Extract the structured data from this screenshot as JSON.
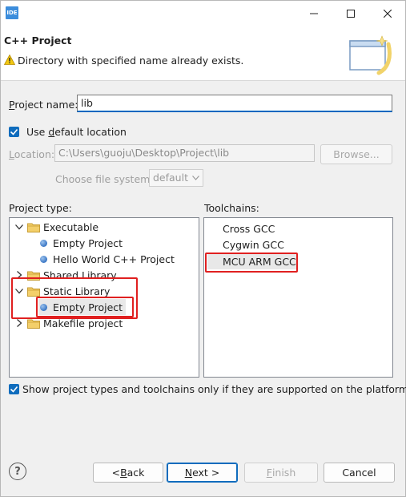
{
  "titlebar": {
    "app_icon": "IDE"
  },
  "banner": {
    "title": "C++ Project",
    "message": "Directory with specified name already exists."
  },
  "project_name": {
    "label_pre": "",
    "label_mnemonic": "P",
    "label_post": "roject name:",
    "value": "lib"
  },
  "default_location": {
    "label_pre": "Use ",
    "label_mnemonic": "d",
    "label_post": "efault location",
    "checked": true
  },
  "location": {
    "label_mnemonic": "L",
    "label_post": "ocation:",
    "value": "C:\\Users\\guoju\\Desktop\\Project\\lib",
    "browse_label": "Browse..."
  },
  "file_system": {
    "label": "Choose file system:",
    "value": "default"
  },
  "project_type": {
    "label": "Project type:",
    "items": [
      {
        "label": "Executable",
        "kind": "folder",
        "expanded": true
      },
      {
        "label": "Empty Project",
        "kind": "leaf"
      },
      {
        "label": "Hello World C++ Project",
        "kind": "leaf"
      },
      {
        "label": "Shared Library",
        "kind": "folder",
        "expanded": false
      },
      {
        "label": "Static Library",
        "kind": "folder",
        "expanded": true
      },
      {
        "label": "Empty Project",
        "kind": "leaf",
        "selected": true
      },
      {
        "label": "Makefile project",
        "kind": "folder",
        "expanded": false
      }
    ]
  },
  "toolchains": {
    "label": "Toolchains:",
    "items": [
      {
        "label": "Cross GCC"
      },
      {
        "label": "Cygwin GCC"
      },
      {
        "label": "MCU ARM GCC",
        "selected": true
      }
    ]
  },
  "show_supported": {
    "label": "Show project types and toolchains only if they are supported on the platform",
    "checked": true
  },
  "buttons": {
    "back_pre": "< ",
    "back_mnemonic": "B",
    "back_post": "ack",
    "next_mnemonic": "N",
    "next_post": "ext >",
    "finish_mnemonic": "F",
    "finish_post": "inish",
    "cancel": "Cancel"
  },
  "colors": {
    "accent": "#0f6cbd",
    "highlight_box": "#e02020"
  }
}
